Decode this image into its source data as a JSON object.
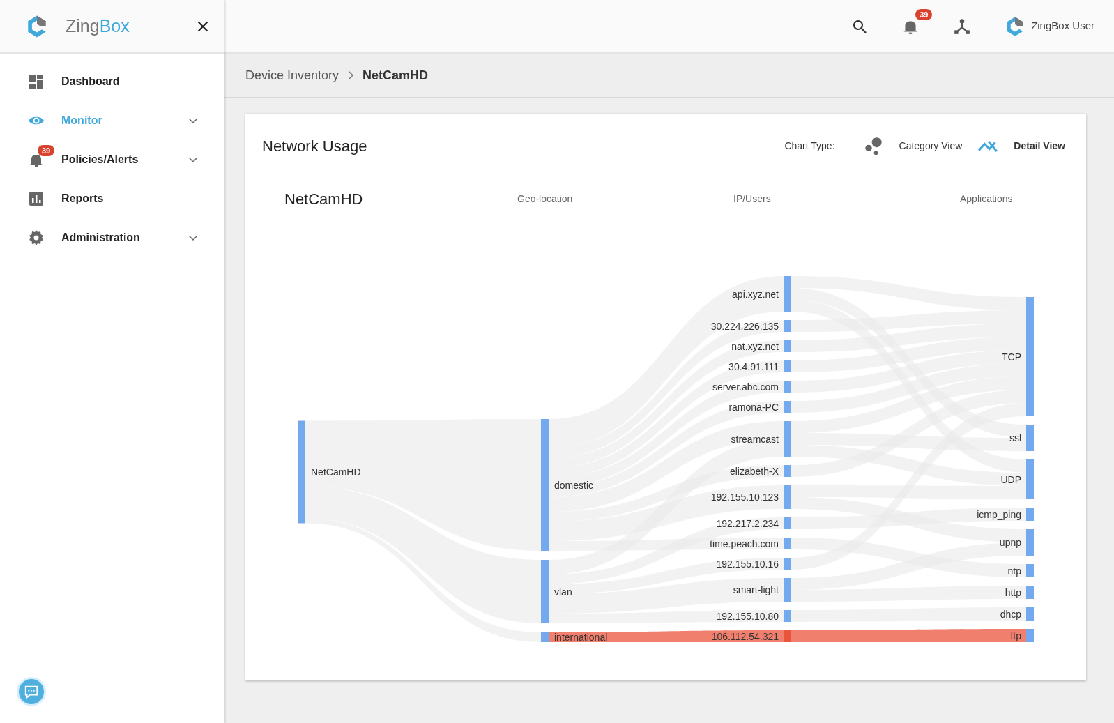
{
  "brand": {
    "first": "Zing",
    "second": "Box"
  },
  "sidebar": {
    "items": [
      {
        "label": "Dashboard",
        "selected": false,
        "expandable": false
      },
      {
        "label": "Monitor",
        "selected": true,
        "expandable": true
      },
      {
        "label": "Policies/Alerts",
        "selected": false,
        "expandable": true,
        "badge": "39"
      },
      {
        "label": "Reports",
        "selected": false,
        "expandable": false
      },
      {
        "label": "Administration",
        "selected": false,
        "expandable": true
      }
    ]
  },
  "topbar": {
    "alert_count": "39",
    "user": "ZingBox User"
  },
  "breadcrumb": [
    {
      "label": "Device Inventory",
      "current": false
    },
    {
      "label": "NetCamHD",
      "current": true
    }
  ],
  "card": {
    "title": "Network Usage",
    "chart_type_label": "Chart Type:",
    "views": [
      {
        "label": "Category View",
        "selected": false
      },
      {
        "label": "Detail View",
        "selected": true
      }
    ],
    "sankey": {
      "title": "NetCamHD",
      "column_headings": [
        "Geo-location",
        "IP/Users",
        "Applications"
      ],
      "columns": [
        [
          {
            "label": "NetCamHD",
            "alert": false
          }
        ],
        [
          {
            "label": "domestic",
            "alert": false
          },
          {
            "label": "vlan",
            "alert": false
          },
          {
            "label": "international",
            "alert": false
          }
        ],
        [
          {
            "label": "api.xyz.net",
            "alert": false
          },
          {
            "label": "30.224.226.135",
            "alert": false
          },
          {
            "label": "nat.xyz.net",
            "alert": false
          },
          {
            "label": "30.4.91.111",
            "alert": false
          },
          {
            "label": "server.abc.com",
            "alert": false
          },
          {
            "label": "ramona-PC",
            "alert": false
          },
          {
            "label": "streamcast",
            "alert": false
          },
          {
            "label": "elizabeth-X",
            "alert": false
          },
          {
            "label": "192.155.10.123",
            "alert": false
          },
          {
            "label": "192.217.2.234",
            "alert": false
          },
          {
            "label": "time.peach.com",
            "alert": false
          },
          {
            "label": "192.155.10.16",
            "alert": false
          },
          {
            "label": "smart-light",
            "alert": false
          },
          {
            "label": "192.155.10.80",
            "alert": false
          },
          {
            "label": "106.112.54.321",
            "alert": true
          }
        ],
        [
          {
            "label": "TCP",
            "alert": false
          },
          {
            "label": "ssl",
            "alert": false
          },
          {
            "label": "UDP",
            "alert": false
          },
          {
            "label": "icmp_ping",
            "alert": false
          },
          {
            "label": "upnp",
            "alert": false
          },
          {
            "label": "ntp",
            "alert": false
          },
          {
            "label": "http",
            "alert": false
          },
          {
            "label": "dhcp",
            "alert": false
          },
          {
            "label": "ftp",
            "alert": false
          }
        ]
      ]
    }
  }
}
